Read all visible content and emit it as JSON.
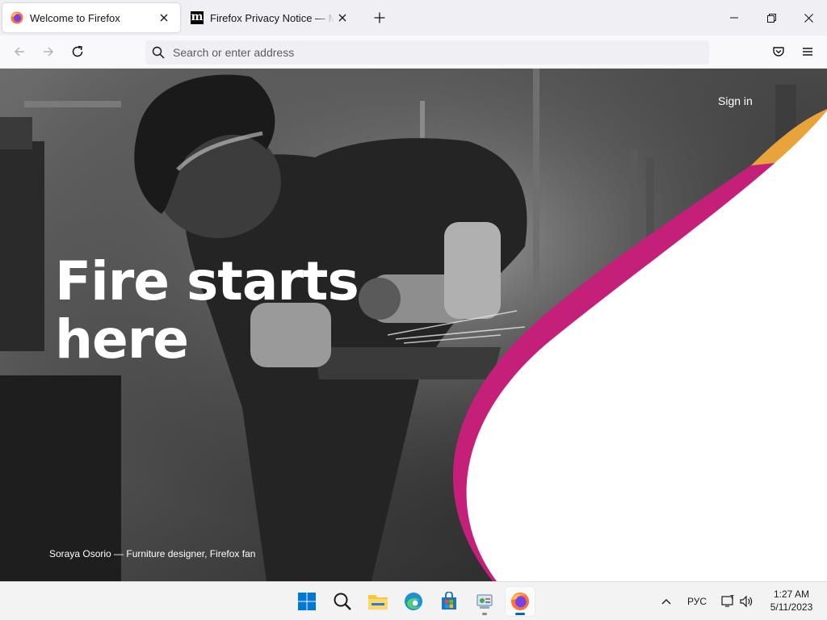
{
  "window": {
    "tabs": [
      {
        "title": "Welcome to Firefox",
        "icon": "firefox-icon",
        "active": true
      },
      {
        "title": "Firefox Privacy Notice — Mozilla",
        "icon": "mozilla-m-icon",
        "active": false
      }
    ],
    "controls": [
      "minimize-icon",
      "restore-icon",
      "close-icon"
    ]
  },
  "toolbar": {
    "buttons": [
      "back-icon",
      "forward-icon",
      "reload-icon"
    ],
    "search_placeholder": "Search or enter address",
    "right_icons": [
      "pocket-icon",
      "menu-icon"
    ]
  },
  "page": {
    "signin_label": "Sign in",
    "headline_line1": "Fire starts",
    "headline_line2": "here",
    "caption": "Soraya Osorio — Furniture designer, Firefox fan",
    "colors": {
      "accent_magenta": "#c4207a",
      "accent_orange": "#e8a33a",
      "panel": "#ffffff"
    }
  },
  "taskbar": {
    "apps": [
      "windows-start-icon",
      "search-icon",
      "file-explorer-icon",
      "edge-icon",
      "microsoft-store-icon",
      "control-panel-icon",
      "firefox-icon"
    ],
    "language": "РУС",
    "time": "1:27 AM",
    "date": "5/11/2023"
  }
}
